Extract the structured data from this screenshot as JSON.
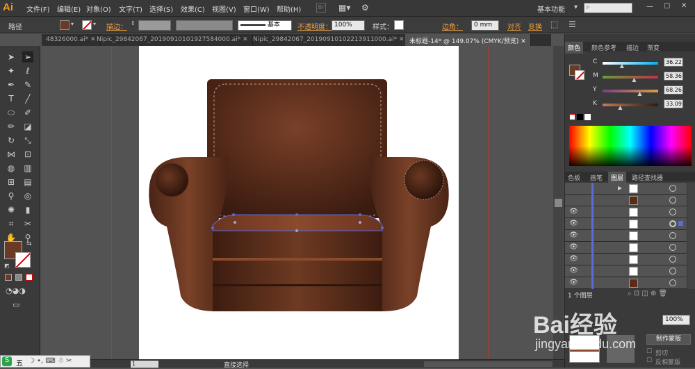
{
  "app": {
    "logo": "Ai"
  },
  "menu": [
    "文件(F)",
    "编辑(E)",
    "对象(O)",
    "文字(T)",
    "选择(S)",
    "效果(C)",
    "视图(V)",
    "窗口(W)",
    "帮助(H)"
  ],
  "menu_right": {
    "bridge": "Br",
    "workspace": "基本功能",
    "search_placeholder": ""
  },
  "control": {
    "object_type": "路径",
    "stroke_label": "描边：",
    "stroke_profile": "基本",
    "opacity_label": "不透明度：",
    "opacity_value": "100%",
    "style_label": "样式：",
    "corner_label": "边角：",
    "corner_value": "0 mm",
    "align_label": "对齐",
    "transform_label": "变换",
    "fill_color": "#6b3a24"
  },
  "tabs": [
    {
      "label": "48326000.ai* ✕",
      "active": false
    },
    {
      "label": "Nipic_29842067_20190910101927584000.ai* ✕",
      "active": false
    },
    {
      "label": "Nipic_29842067_20190910102213911000.ai* ✕",
      "active": false
    },
    {
      "label": "未标题-14* @ 149.07% (CMYK/预览) ✕",
      "active": true
    }
  ],
  "color_panel": {
    "tabs": [
      "颜色",
      "颜色参考",
      "描边",
      "渐变"
    ],
    "channels": [
      {
        "name": "C",
        "value": "36.22",
        "level": 0.36,
        "gradient": "linear-gradient(90deg,#fff,#00aeef)"
      },
      {
        "name": "M",
        "value": "58.36",
        "level": 0.58,
        "gradient": "linear-gradient(90deg,#6b9c3a,#c0304a)"
      },
      {
        "name": "Y",
        "value": "68.26",
        "level": 0.68,
        "gradient": "linear-gradient(90deg,#7a3c8c,#d8a040)"
      },
      {
        "name": "K",
        "value": "33.09",
        "level": 0.33,
        "gradient": "linear-gradient(90deg,#c47a52,#2a1a12)"
      }
    ]
  },
  "layers_panel": {
    "tabs": [
      "色板",
      "画笔",
      "图层",
      "路径查找器"
    ],
    "footer": "1 个图层",
    "rows": 9
  },
  "transparency_panel": {
    "make_mask": "制作蒙版",
    "clip": "剪切",
    "invert": "反相蒙版",
    "opacity": "100%"
  },
  "status": {
    "zoom": "149.07%",
    "page": "1",
    "tool": "直接选择"
  },
  "watermark": {
    "line1": "Bai经验",
    "line2": "jingyan.baidu.com"
  },
  "taskbar": [
    "五"
  ],
  "colors": {
    "chair_dark": "#3e1d12",
    "chair_mid": "#6b3a24",
    "chair_light": "#8a4c30",
    "stitch": "#b28a74",
    "selection": "#5e6ad8"
  }
}
